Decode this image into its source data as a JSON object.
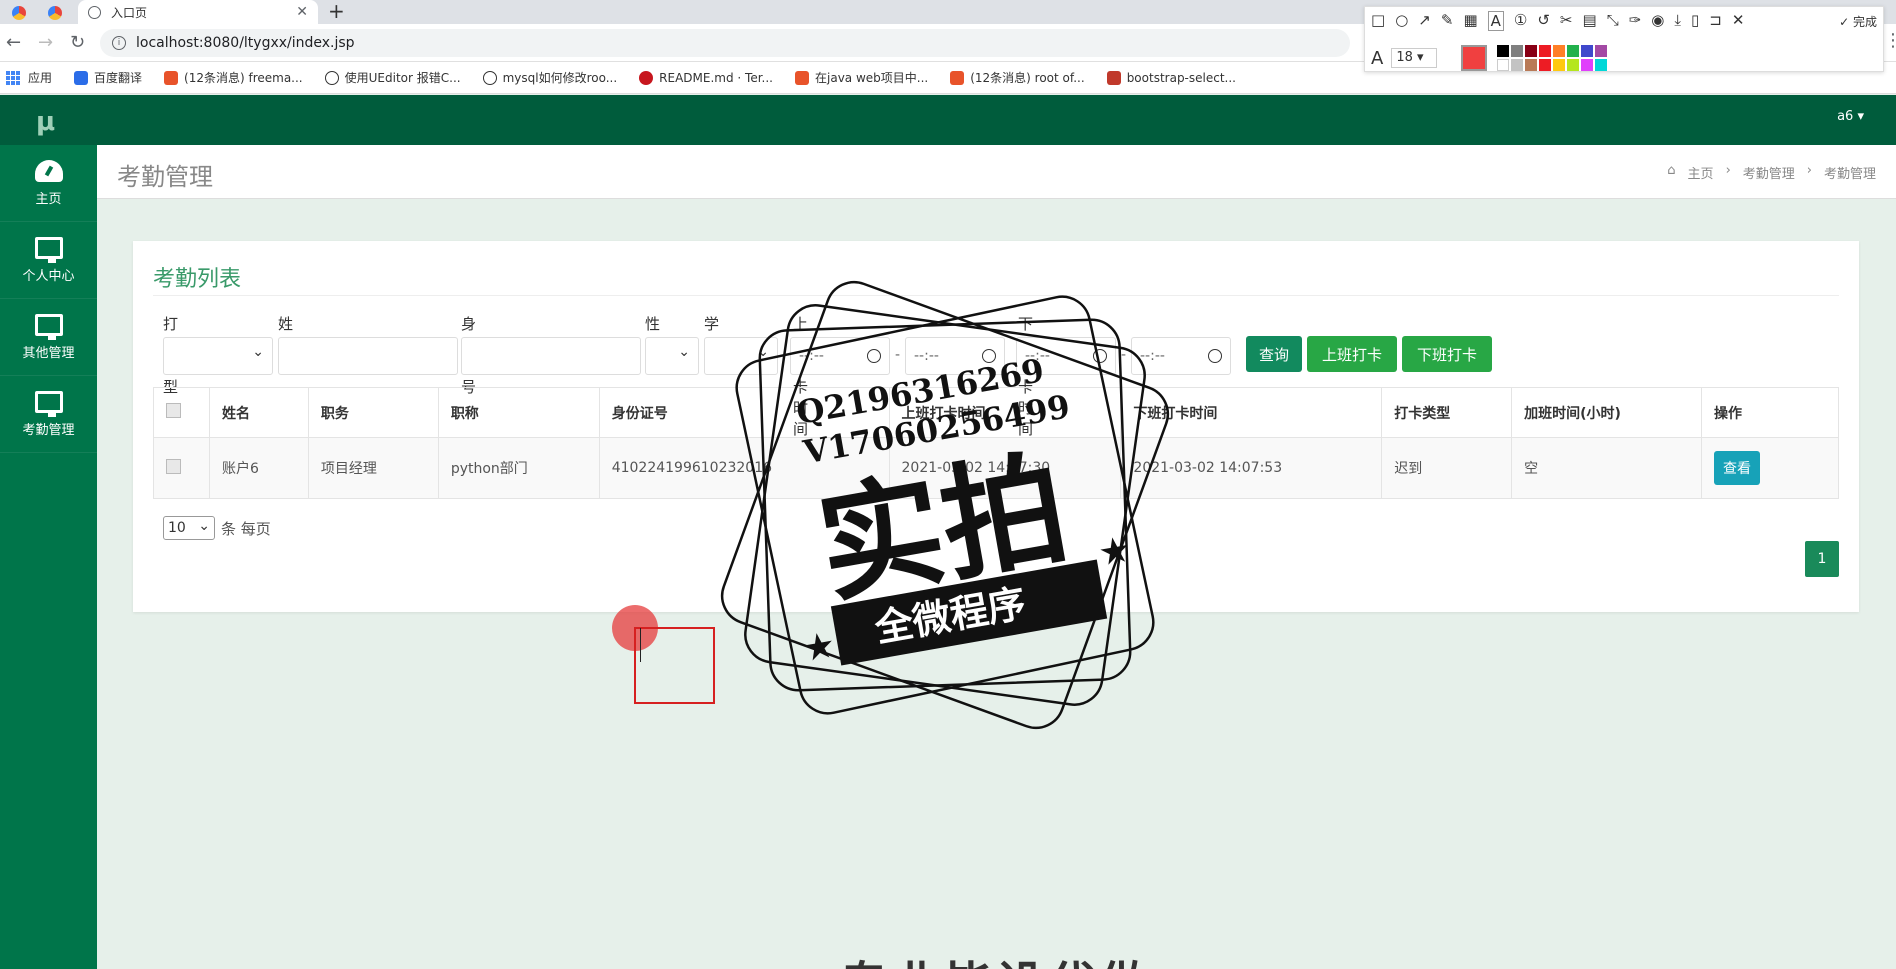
{
  "browser": {
    "tab_title": "入口页",
    "tab_close": "✕",
    "new_tab": "+",
    "address": "localhost:8080/ltygxx/index.jsp",
    "bookmarks": [
      {
        "label": "应用",
        "color": "#4285f4"
      },
      {
        "label": "百度翻译",
        "color": "#2b6de8"
      },
      {
        "label": "(12条消息) freema...",
        "color": "#e8532a"
      },
      {
        "label": "使用UEditor 报错C...",
        "color": "#333333"
      },
      {
        "label": "mysql如何修改roo...",
        "color": "#333333"
      },
      {
        "label": "README.md · Ter...",
        "color": "#c7161e"
      },
      {
        "label": "在java web项目中...",
        "color": "#e8532a"
      },
      {
        "label": "(12条消息) root of...",
        "color": "#e8532a"
      },
      {
        "label": "bootstrap-select...",
        "color": "#c0392b"
      }
    ]
  },
  "shot_tool": {
    "done_label": "完成",
    "font_size": "18",
    "icons": [
      "rect-icon",
      "ellipse-icon",
      "arrow-icon",
      "pen-icon",
      "mosaic-icon",
      "text-icon",
      "number-icon",
      "undo-icon",
      "cut-icon",
      "ocr-icon",
      "scale-icon",
      "pin-icon",
      "record-icon",
      "save-icon",
      "copy-icon",
      "bookmark-icon",
      "close-icon"
    ],
    "current_color": "#f04040",
    "palette": [
      "#000000",
      "#7f7f7f",
      "#880015",
      "#ed1c24",
      "#ff7f27",
      "#22b14c",
      "#3f48cc",
      "#a349a4",
      "#ffffff",
      "#c3c3c3",
      "#b97a57",
      "#ffaec9",
      "#ffc90e",
      "#b5e61d",
      "#99d9ea",
      "#00a2e8"
    ]
  },
  "app": {
    "logo": "μ",
    "user_label": "a6 ▾"
  },
  "sidebar": {
    "items": [
      {
        "label": "主页",
        "icon": "dashboard-icon"
      },
      {
        "label": "个人中心",
        "icon": "monitor-icon"
      },
      {
        "label": "其他管理",
        "icon": "monitor-icon"
      },
      {
        "label": "考勤管理",
        "icon": "monitor-icon"
      }
    ]
  },
  "page": {
    "title": "考勤管理",
    "breadcrumb": [
      "主页",
      "考勤管理",
      "考勤管理"
    ]
  },
  "card": {
    "title": "考勤列表",
    "filters": {
      "punch_type": "打卡类型",
      "name": "姓名",
      "id_number": "身份证号",
      "gender": "性别",
      "education": "学历",
      "on_time": "上班打卡时间",
      "off_time": "下班打卡时间",
      "time_placeholder": "--:--",
      "dash": "-"
    },
    "buttons": {
      "query": "查询",
      "punch_in": "上班打卡",
      "punch_out": "下班打卡"
    },
    "table": {
      "headers": [
        "姓名",
        "职务",
        "职称",
        "身份证号",
        "上班打卡时间",
        "下班打卡时间",
        "打卡类型",
        "加班时间(小时)",
        "操作"
      ],
      "rows": [
        {
          "name": "账户6",
          "position": "项目经理",
          "title": "python部门",
          "id_number": "410224199610232016",
          "on_time": "2021-03-02 14:07:30",
          "off_time": "2021-03-02 14:07:53",
          "type": "迟到",
          "overtime": "空",
          "action": "查看"
        }
      ]
    },
    "page_size": "10",
    "page_size_suffix": "条 每页",
    "current_page": "1"
  },
  "watermark": {
    "line1": "Q2196316269",
    "line2": "V17060256499",
    "big": "实拍",
    "banner": "全微程序"
  },
  "bottom_text": "专业毕设代做"
}
